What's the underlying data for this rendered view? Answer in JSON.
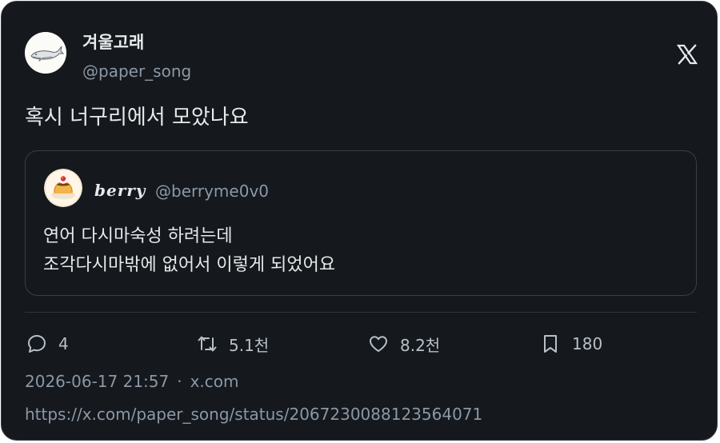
{
  "author": {
    "name": "겨울고래",
    "handle": "@paper_song"
  },
  "tweet": {
    "text": "혹시 너구리에서 모았나요"
  },
  "quote": {
    "name": "berry",
    "handle": "@berryme0v0",
    "lines": [
      "연어 다시마숙성 하려는데",
      "조각다시마밖에 없어서 이렇게 되었어요"
    ]
  },
  "actions": {
    "replies": "4",
    "retweets": "5.1천",
    "likes": "8.2천",
    "bookmarks": "180"
  },
  "meta": {
    "timestamp": "2026-06-17 21:57",
    "separator": "·",
    "source": "x.com",
    "url": "https://x.com/paper_song/status/2067230088123564071"
  },
  "icons": {
    "reply": "speech-bubble-icon",
    "retweet": "retweet-icon",
    "like": "heart-icon",
    "bookmark": "bookmark-icon",
    "platform": "x-logo-icon"
  },
  "colors": {
    "background": "#15181d",
    "text_primary": "#e7e9ea",
    "text_secondary": "#8b98a5",
    "border": "#3a3f46"
  }
}
